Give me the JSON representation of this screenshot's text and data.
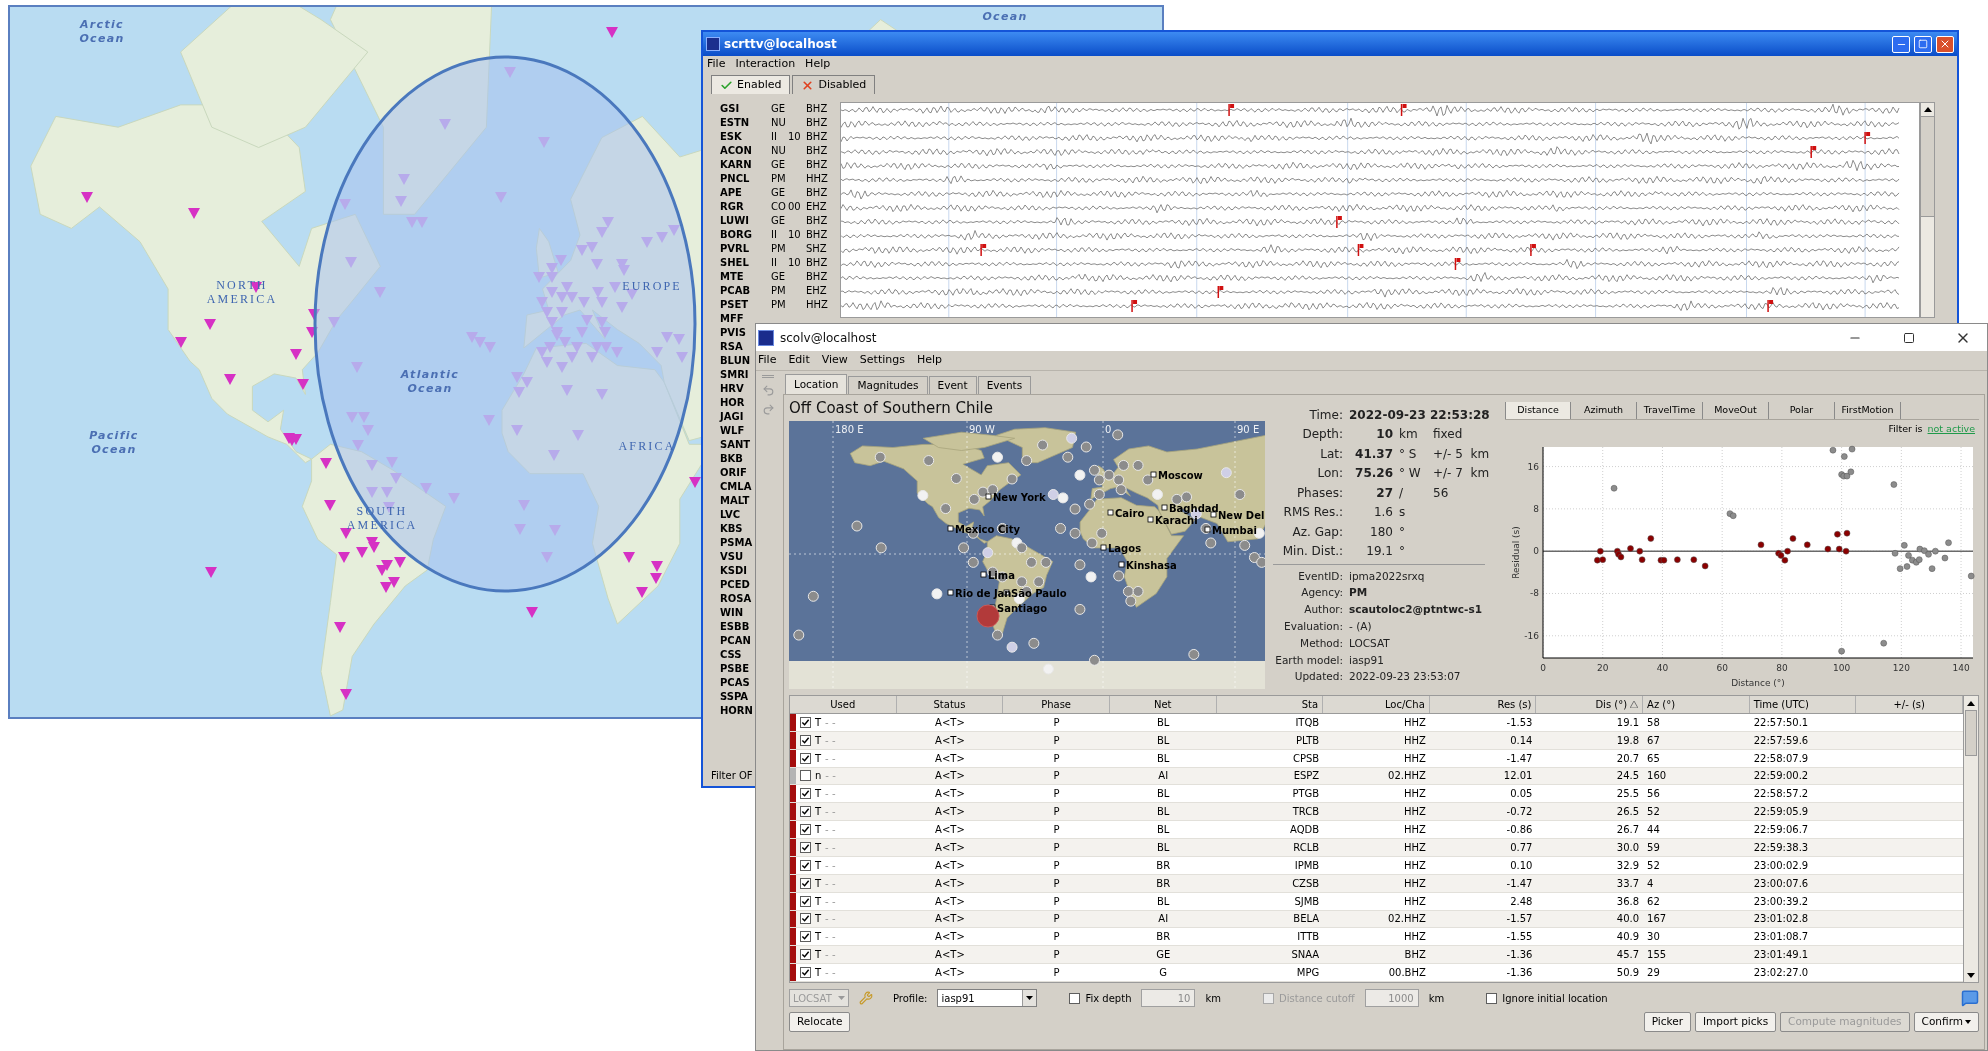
{
  "map": {
    "labels": [
      {
        "text": "Arctic Ocean",
        "kind": "ocean"
      },
      {
        "text": "Ocean",
        "kind": "ocean"
      },
      {
        "text": "NORTH AMERICA",
        "kind": "continent"
      },
      {
        "text": "EUROPE",
        "kind": "continent"
      },
      {
        "text": "Pacific Ocean",
        "kind": "ocean"
      },
      {
        "text": "Atlantic Ocean",
        "kind": "ocean"
      },
      {
        "text": "AFRICA",
        "kind": "continent"
      },
      {
        "text": "SOUTH AMERICA",
        "kind": "continent"
      }
    ]
  },
  "scrttv": {
    "title": "scrttv@localhost",
    "menu": [
      "File",
      "Interaction",
      "Help"
    ],
    "tabs": [
      {
        "label": "Enabled",
        "selected": true,
        "kind": "enabled"
      },
      {
        "label": "Disabled",
        "selected": false,
        "kind": "disabled"
      }
    ],
    "streams": [
      {
        "station": "GSI",
        "network": "GE",
        "channel": "BHZ"
      },
      {
        "station": "ESTN",
        "network": "NU",
        "channel": "BHZ"
      },
      {
        "station": "ESK",
        "network": "II",
        "location": "10",
        "channel": "BHZ"
      },
      {
        "station": "ACON",
        "network": "NU",
        "channel": "BHZ"
      },
      {
        "station": "KARN",
        "network": "GE",
        "channel": "BHZ"
      },
      {
        "station": "PNCL",
        "network": "PM",
        "channel": "HHZ"
      },
      {
        "station": "APE",
        "network": "GE",
        "channel": "BHZ"
      },
      {
        "station": "RGR",
        "network": "CO",
        "location": "00",
        "channel": "EHZ"
      },
      {
        "station": "LUWI",
        "network": "GE",
        "channel": "BHZ"
      },
      {
        "station": "BORG",
        "network": "II",
        "location": "10",
        "channel": "BHZ"
      },
      {
        "station": "PVRL",
        "network": "PM",
        "channel": "SHZ"
      },
      {
        "station": "SHEL",
        "network": "II",
        "location": "10",
        "channel": "BHZ"
      },
      {
        "station": "MTE",
        "network": "GE",
        "channel": "BHZ"
      },
      {
        "station": "PCAB",
        "network": "PM",
        "channel": "EHZ"
      },
      {
        "station": "PSET",
        "network": "PM",
        "channel": "HHZ"
      },
      {
        "station": "MFF"
      },
      {
        "station": "PVIS"
      },
      {
        "station": "RSA"
      },
      {
        "station": "BLUN"
      },
      {
        "station": "SMRI"
      },
      {
        "station": "HRV"
      },
      {
        "station": "HOR"
      },
      {
        "station": "JAGI"
      },
      {
        "station": "WLF"
      },
      {
        "station": "SANT"
      },
      {
        "station": "BKB"
      },
      {
        "station": "ORIF"
      },
      {
        "station": "CMLA"
      },
      {
        "station": "MALT"
      },
      {
        "station": "LVC"
      },
      {
        "station": "KBS"
      },
      {
        "station": "PSMA"
      },
      {
        "station": "VSU"
      },
      {
        "station": "KSDI"
      },
      {
        "station": "PCED"
      },
      {
        "station": "ROSA"
      },
      {
        "station": "WIN"
      },
      {
        "station": "ESBB"
      },
      {
        "station": "PCAN"
      },
      {
        "station": "CSS"
      },
      {
        "station": "PSBE"
      },
      {
        "station": "PCAS"
      },
      {
        "station": "SSPA"
      },
      {
        "station": "HORN"
      }
    ],
    "filter": "Filter OF"
  },
  "scolv": {
    "title": "scolv@localhost",
    "menu": [
      "File",
      "Edit",
      "View",
      "Settings",
      "Help"
    ],
    "tabs": [
      {
        "label": "Location",
        "selected": true
      },
      {
        "label": "Magnitudes",
        "selected": false
      },
      {
        "label": "Event",
        "selected": false
      },
      {
        "label": "Events",
        "selected": false
      }
    ],
    "region": "Off Coast of Southern Chile",
    "map": {
      "grid_labels": [
        "180 E",
        "90 W",
        "0",
        "90 E"
      ],
      "cities": [
        "Moscow",
        "New York",
        "Cairo",
        "Baghdad",
        "Karachi",
        "New Del",
        "Mumbai",
        "Mexico City",
        "Lagos",
        "Kinshasa",
        "Lima",
        "Rio de Jan",
        "São Paulo",
        "Santiago"
      ]
    },
    "summary": [
      {
        "label": "Time:",
        "value": "2022-09-23 22:53:28",
        "bold": true
      },
      {
        "label": "Depth:",
        "value": "10",
        "unit": "km",
        "note": "fixed",
        "bold": true
      },
      {
        "label": "Lat:",
        "value": "41.37",
        "unit": "° S",
        "note": "+/- 5  km",
        "bold": true
      },
      {
        "label": "Lon:",
        "value": "75.26",
        "unit": "° W",
        "note": "+/- 7  km",
        "bold": true
      },
      {
        "label": "Phases:",
        "value": "27",
        "unit": "/",
        "note": "56",
        "bold": true
      },
      {
        "label": "RMS Res.:",
        "value": "1.6",
        "unit": "s",
        "bold": false
      },
      {
        "label": "Az. Gap:",
        "value": "180",
        "unit": "°",
        "bold": false
      },
      {
        "label": "Min. Dist.:",
        "value": "19.1",
        "unit": "°",
        "bold": false
      }
    ],
    "details": [
      {
        "label": "EventID:",
        "value": "ipma2022srxq",
        "bold": false
      },
      {
        "label": "Agency:",
        "value": "PM",
        "bold": true
      },
      {
        "label": "Author:",
        "value": "scautoloc2@ptntwc-s1",
        "bold": true
      },
      {
        "label": "Evaluation:",
        "value": "- (A)",
        "bold": false
      },
      {
        "label": "Method:",
        "value": "LOCSAT",
        "bold": false
      },
      {
        "label": "Earth model:",
        "value": "iasp91",
        "bold": false
      },
      {
        "label": "Updated:",
        "value": "2022-09-23 23:53:07",
        "bold": false
      }
    ],
    "plot": {
      "tabs": [
        {
          "label": "Distance",
          "selected": true
        },
        {
          "label": "Azimuth",
          "selected": false
        },
        {
          "label": "TravelTime",
          "selected": false
        },
        {
          "label": "MoveOut",
          "selected": false
        },
        {
          "label": "Polar",
          "selected": false
        },
        {
          "label": "FirstMotion",
          "selected": false
        }
      ],
      "filter_label": "Filter is",
      "filter_state": "not active",
      "chart_data": {
        "type": "scatter",
        "grid": true,
        "xlabel": "Distance (°)",
        "ylabel": "Residual (s)",
        "xlim": [
          0,
          144
        ],
        "ylim": [
          -20.2,
          19.7
        ],
        "xticks": [
          0,
          20,
          40,
          60,
          80,
          100,
          120,
          140
        ],
        "yticks": [
          -16,
          -8,
          0,
          8,
          16
        ],
        "series": [
          {
            "color": "#8b0000",
            "x": [
              18.2,
              19.2,
              20,
              24.9,
              25.3,
              26.1,
              29.3,
              32.4,
              33.2,
              36.1,
              39.5,
              40.5,
              45,
              50.5,
              54.3,
              73,
              78.9,
              79.7,
              81,
              81.9,
              83.7,
              88.5,
              95.4,
              98.6,
              99.2,
              101.5,
              101.8
            ],
            "values": [
              -1.7,
              0,
              -1.6,
              0,
              -0.6,
              -1.1,
              0.5,
              0,
              -1.6,
              2.4,
              -1.7,
              -1.7,
              -1.6,
              -1.6,
              -2.8,
              1.2,
              -0.4,
              -0.8,
              -1.7,
              0,
              2.4,
              1.2,
              0.4,
              3.2,
              0.4,
              0,
              3.4
            ]
          },
          {
            "color": "#8c8c8c",
            "x": [
              23.8,
              62.6,
              63.7,
              97.1,
              103.5,
              100.9,
              100,
              100.7,
              101.8,
              103.1,
              117.5,
              117.9,
              119.6,
              121,
              121.9,
              122.4,
              123.7,
              125,
              126,
              126.2,
              127.7,
              129.1,
              130.3,
              131.4,
              134.6,
              135.8,
              143.4,
              114.1,
              100
            ],
            "values": [
              11.9,
              7.1,
              6.7,
              19.1,
              19.3,
              17.9,
              14.5,
              14.2,
              14.2,
              15,
              12.6,
              -0.4,
              -3.3,
              1.1,
              -2.9,
              -0.8,
              -1.7,
              -2.1,
              -1.6,
              0.4,
              0.1,
              -0.6,
              -3.3,
              0,
              -1.3,
              1.6,
              -4.7,
              -17.4,
              -18.9
            ]
          }
        ]
      }
    },
    "table": {
      "columns": [
        {
          "label": "Used",
          "sorted": false
        },
        {
          "label": "Status",
          "sorted": false
        },
        {
          "label": "Phase",
          "sorted": false
        },
        {
          "label": "Net",
          "sorted": false
        },
        {
          "label": "Sta",
          "sorted": false
        },
        {
          "label": "Loc/Cha",
          "sorted": false
        },
        {
          "label": "Res (s)",
          "sorted": false
        },
        {
          "label": "Dis (°)",
          "sorted": true
        },
        {
          "label": "Az (°)",
          "sorted": false
        },
        {
          "label": "Time (UTC)",
          "sorted": false
        },
        {
          "label": "+/- (s)",
          "sorted": false
        }
      ],
      "rows": [
        {
          "used": true,
          "flag": "T",
          "marks": "- -",
          "status": "A<T>",
          "phase": "P",
          "net": "BL",
          "sta": "ITQB",
          "loccha": "HHZ",
          "res": "-1.53",
          "dis": "19.1",
          "az": "58",
          "time": "22:57:50.1"
        },
        {
          "used": true,
          "flag": "T",
          "marks": "- -",
          "status": "A<T>",
          "phase": "P",
          "net": "BL",
          "sta": "PLTB",
          "loccha": "HHZ",
          "res": "0.14",
          "dis": "19.8",
          "az": "67",
          "time": "22:57:59.6"
        },
        {
          "used": true,
          "flag": "T",
          "marks": "- -",
          "status": "A<T>",
          "phase": "P",
          "net": "BL",
          "sta": "CPSB",
          "loccha": "HHZ",
          "res": "-1.47",
          "dis": "20.7",
          "az": "65",
          "time": "22:58:07.9"
        },
        {
          "used": false,
          "flag": "n",
          "marks": "- -",
          "status": "A<T>",
          "phase": "P",
          "net": "AI",
          "sta": "ESPZ",
          "loccha": "02.HHZ",
          "res": "12.01",
          "dis": "24.5",
          "az": "160",
          "time": "22:59:00.2"
        },
        {
          "used": true,
          "flag": "T",
          "marks": "- -",
          "status": "A<T>",
          "phase": "P",
          "net": "BL",
          "sta": "PTGB",
          "loccha": "HHZ",
          "res": "0.05",
          "dis": "25.5",
          "az": "56",
          "time": "22:58:57.2"
        },
        {
          "used": true,
          "flag": "T",
          "marks": "- -",
          "status": "A<T>",
          "phase": "P",
          "net": "BL",
          "sta": "TRCB",
          "loccha": "HHZ",
          "res": "-0.72",
          "dis": "26.5",
          "az": "52",
          "time": "22:59:05.9"
        },
        {
          "used": true,
          "flag": "T",
          "marks": "- -",
          "status": "A<T>",
          "phase": "P",
          "net": "BL",
          "sta": "AQDB",
          "loccha": "HHZ",
          "res": "-0.86",
          "dis": "26.7",
          "az": "44",
          "time": "22:59:06.7"
        },
        {
          "used": true,
          "flag": "T",
          "marks": "- -",
          "status": "A<T>",
          "phase": "P",
          "net": "BL",
          "sta": "RCLB",
          "loccha": "HHZ",
          "res": "0.77",
          "dis": "30.0",
          "az": "59",
          "time": "22:59:38.3"
        },
        {
          "used": true,
          "flag": "T",
          "marks": "- -",
          "status": "A<T>",
          "phase": "P",
          "net": "BR",
          "sta": "IPMB",
          "loccha": "HHZ",
          "res": "0.10",
          "dis": "32.9",
          "az": "52",
          "time": "23:00:02.9"
        },
        {
          "used": true,
          "flag": "T",
          "marks": "- -",
          "status": "A<T>",
          "phase": "P",
          "net": "BR",
          "sta": "CZSB",
          "loccha": "HHZ",
          "res": "-1.47",
          "dis": "33.7",
          "az": "4",
          "time": "23:00:07.6"
        },
        {
          "used": true,
          "flag": "T",
          "marks": "- -",
          "status": "A<T>",
          "phase": "P",
          "net": "BL",
          "sta": "SJMB",
          "loccha": "HHZ",
          "res": "2.48",
          "dis": "36.8",
          "az": "62",
          "time": "23:00:39.2"
        },
        {
          "used": true,
          "flag": "T",
          "marks": "- -",
          "status": "A<T>",
          "phase": "P",
          "net": "AI",
          "sta": "BELA",
          "loccha": "02.HHZ",
          "res": "-1.57",
          "dis": "40.0",
          "az": "167",
          "time": "23:01:02.8"
        },
        {
          "used": true,
          "flag": "T",
          "marks": "- -",
          "status": "A<T>",
          "phase": "P",
          "net": "BR",
          "sta": "ITTB",
          "loccha": "HHZ",
          "res": "-1.55",
          "dis": "40.9",
          "az": "30",
          "time": "23:01:08.7"
        },
        {
          "used": true,
          "flag": "T",
          "marks": "- -",
          "status": "A<T>",
          "phase": "P",
          "net": "GE",
          "sta": "SNAA",
          "loccha": "BHZ",
          "res": "-1.36",
          "dis": "45.7",
          "az": "155",
          "time": "23:01:49.1"
        },
        {
          "used": true,
          "flag": "T",
          "marks": "- -",
          "status": "A<T>",
          "phase": "P",
          "net": "G",
          "sta": "MPG",
          "loccha": "00.BHZ",
          "res": "-1.36",
          "dis": "50.9",
          "az": "29",
          "time": "23:02:27.0"
        }
      ]
    },
    "controls": {
      "locator": {
        "value": "LOCSAT",
        "disabled": true
      },
      "profile": {
        "label": "Profile:",
        "value": "iasp91"
      },
      "fix_depth": {
        "label": "Fix depth",
        "checked": false
      },
      "depth": {
        "value": "10",
        "unit": "km",
        "disabled": true
      },
      "distance_cutoff": {
        "label": "Distance cutoff",
        "checked": false,
        "disabled": true
      },
      "cutoff": {
        "value": "1000",
        "unit": "km",
        "disabled": true
      },
      "ignore_initial": {
        "label": "Ignore initial location",
        "checked": false
      }
    },
    "left_buttons": [
      {
        "label": "Relocate",
        "disabled": false,
        "menu": false
      }
    ],
    "right_buttons": [
      {
        "label": "Picker",
        "disabled": false,
        "menu": false
      },
      {
        "label": "Import picks",
        "disabled": false,
        "menu": false
      },
      {
        "label": "Compute magnitudes",
        "disabled": true,
        "menu": false
      },
      {
        "label": "Confirm",
        "disabled": false,
        "menu": true
      }
    ]
  }
}
